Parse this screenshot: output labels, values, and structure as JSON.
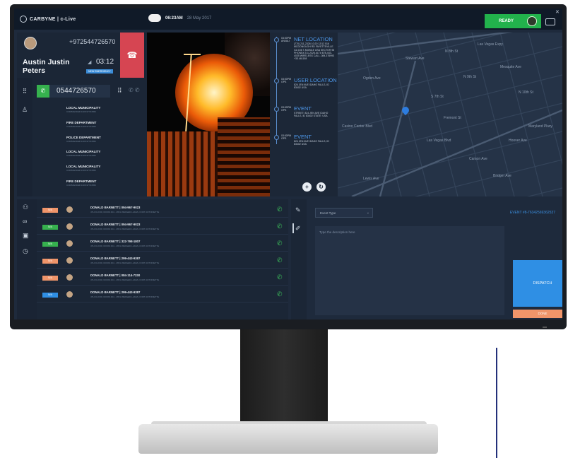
{
  "topbar": {
    "brand": "CARBYNE | c-Live",
    "time": "06:23AM",
    "date": "28 May 2017",
    "ready_label": "READY",
    "close_label": "✕"
  },
  "caller": {
    "phone": "+972544726570",
    "name": "Austin Justin Peters",
    "timer": "03:12",
    "badge": "NEW EMERGENCY"
  },
  "dialer": {
    "number": "0544726570"
  },
  "contacts": [
    {
      "name": "LOCAL MUNICIPALITY",
      "sub": "COMMANDER 1305-97734556"
    },
    {
      "name": "FIRE DEPARTMENT",
      "sub": "COMMANDER 1305-97734556"
    },
    {
      "name": "POLICE DEPARTMENT",
      "sub": "COMMANDER 1305-97734556"
    },
    {
      "name": "LOCAL MUNICIPALITY",
      "sub": "COMMANDER 1305-97734556"
    },
    {
      "name": "LOCAL MUNICIPALITY",
      "sub": "COMMANDER 1305-97734556"
    },
    {
      "name": "FIRE DEPARTMENT",
      "sub": "COMMANDER 1305-97734556"
    }
  ],
  "timeline": [
    {
      "time": "03:00PM ANI/ALI",
      "title": "NET LOCATION",
      "body": "(770) 211-2326 10:20 12/12 516 MCDONOUGH RD FAYETTEVILLE GA 156 T-MOBILE USA SECTOR 96 PHONE# 211-2326 ALT# 678-443-4035 WIRELESS CALL -084.376993 +33.461158"
    },
    {
      "time": "03:00PM GPS",
      "title": "USER LOCATION",
      "body": "824 JEN AVE IDAHO FALLS, ID 83402 USA"
    },
    {
      "time": "03:00PM GPS",
      "title": "EVENT",
      "body": "STREET: 824 JEN AVE IDAHO FALLS, ID 83402 STATE: USA"
    },
    {
      "time": "03:00PM GPS",
      "title": "EVENT",
      "body": "824 JEN AVE IDAHO FALLS, ID 83402 USA"
    }
  ],
  "map_labels": [
    "Las Vegas Expy",
    "Stewart Ave",
    "Ogden Ave",
    "Mesquite Ave",
    "Las Vegas Blvd",
    "Fremont St",
    "Carson Ave",
    "Bridger Ave",
    "Lewis Ave",
    "Maryland Pkwy",
    "N 8th St",
    "N 9th St",
    "N 10th St",
    "S 7th St",
    "Casino Center Blvd",
    "Hoover Ave"
  ],
  "incidents": [
    {
      "badge": "N/A",
      "badge_color": "#f0956a",
      "title": "DONALD BARNETT | 094-967-9023",
      "sub": "4TH FLOOR, ROOM 404 - 2651 WEDGED LAKES, FORT ANTOINETTE"
    },
    {
      "badge": "N/A",
      "badge_color": "#36b14e",
      "title": "DONALD BARNETT | 094-967-9023",
      "sub": "4TH FLOOR, ROOM 404 - 2651 WEDGED LAKES, FORT ANTOINETTE"
    },
    {
      "badge": "N/A",
      "badge_color": "#36b14e",
      "title": "DONALD BARNETT | 322-798-1807",
      "sub": "4TH FLOOR, ROOM 404 - 2651 WEDGED LAKES, FORT ANTOINETTE"
    },
    {
      "badge": "N/A",
      "badge_color": "#f0956a",
      "title": "DONALD BARNETT | 299-443-9387",
      "sub": "4TH FLOOR, ROOM 404 - 2651 WEDGED LAKES, FORT ANTOINETTE"
    },
    {
      "badge": "N/A",
      "badge_color": "#f0956a",
      "title": "DONALD BARNETT | 084-114-7330",
      "sub": "4TH FLOOR, ROOM 404 - 2651 WEDGED LAKES, FORT ANTOINETTE"
    },
    {
      "badge": "N/A",
      "badge_color": "#2f8fe4",
      "title": "DONALD BARNETT | 299-443-9387",
      "sub": "4TH FLOOR, ROOM 404 - 2651 WEDGED LAKES, FORT ANTOINETTE"
    }
  ],
  "event_form": {
    "type_placeholder": "Event Type",
    "event_id": "EVENT #8-76342569362537",
    "desc_placeholder": "Type the description here",
    "dispatch_label": "DISPATCH",
    "done_label": "DONE"
  },
  "colors": {
    "ready": "#22b24c",
    "hangup": "#d64552",
    "accent": "#2f8fe4",
    "done": "#f0956a"
  }
}
